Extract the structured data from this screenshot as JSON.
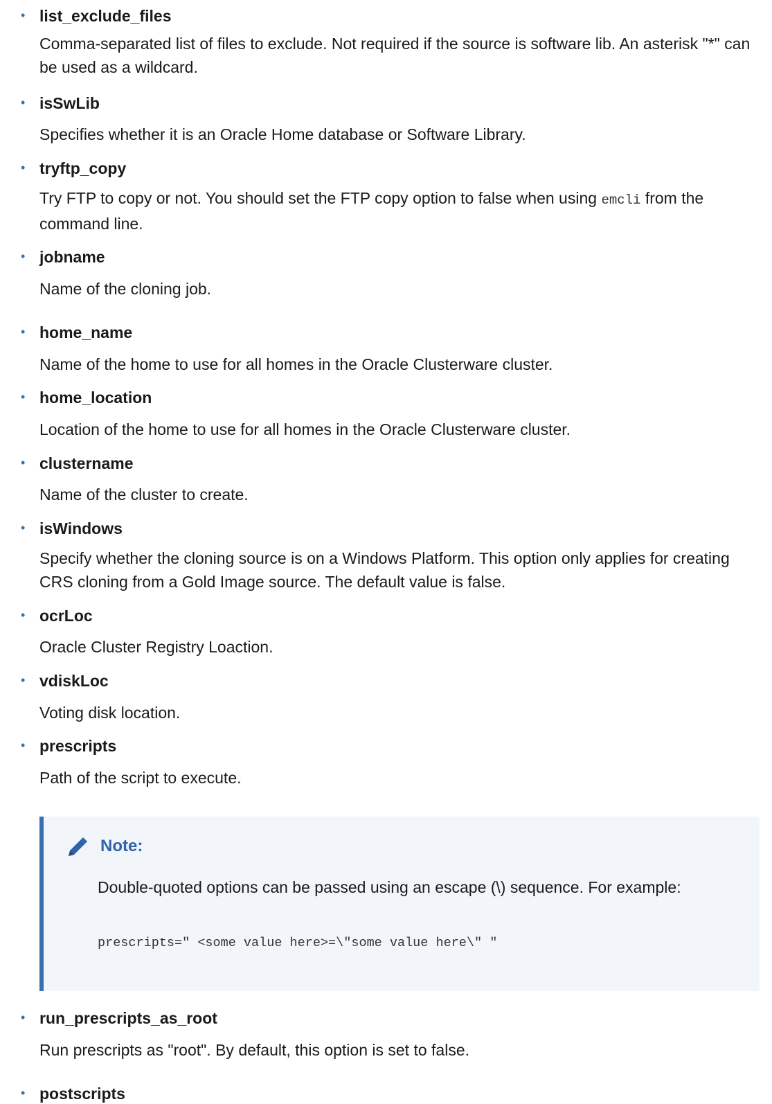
{
  "items": [
    {
      "term": "list_exclude_files",
      "desc": "Comma-separated list of files to exclude. Not required if the source is software lib. An asterisk \"*\" can be used as a wildcard."
    },
    {
      "term": "isSwLib",
      "desc": "Specifies whether it is an Oracle Home database or Software Library."
    },
    {
      "term": "tryftp_copy",
      "desc_before": "Try FTP to copy or not. You should set the FTP copy option to false when using ",
      "desc_code": "emcli",
      "desc_after": " from the command line."
    },
    {
      "term": "jobname",
      "desc": "Name of the cloning job."
    },
    {
      "term": "home_name",
      "desc": "Name of the home to use for all homes in the Oracle Clusterware cluster."
    },
    {
      "term": "home_location",
      "desc": "Location of the home to use for all homes in the Oracle Clusterware cluster."
    },
    {
      "term": "clustername",
      "desc": "Name of the cluster to create."
    },
    {
      "term": "isWindows",
      "desc": "Specify whether the cloning source is on a Windows Platform. This option only applies for creating CRS cloning from a Gold Image source. The default value is false."
    },
    {
      "term": "ocrLoc",
      "desc": "Oracle Cluster Registry Loaction."
    },
    {
      "term": "vdiskLoc",
      "desc": "Voting disk location."
    },
    {
      "term": "prescripts",
      "desc": "Path of the script to execute."
    },
    {
      "term": "run_prescripts_as_root",
      "desc": "Run prescripts as \"root\". By default, this option is set to false."
    },
    {
      "term": "postscripts"
    }
  ],
  "note": {
    "title": "Note:",
    "text": "Double-quoted options can be passed using an escape (\\) sequence. For example:",
    "code": "prescripts=\" <some value here>=\\\"some value here\\\" \""
  },
  "bullet_char": "•",
  "accent_color": "#2f63a8"
}
